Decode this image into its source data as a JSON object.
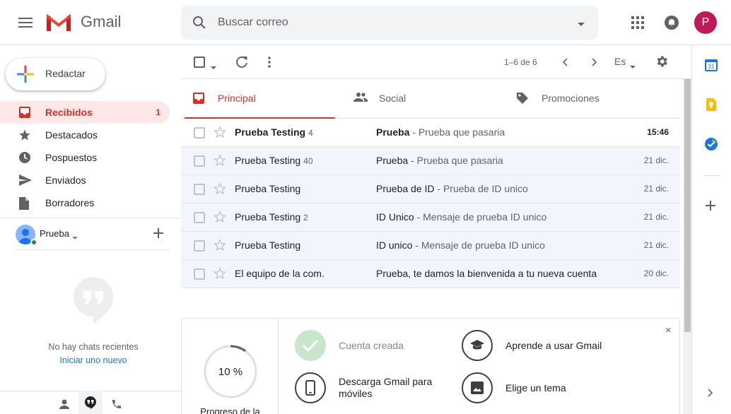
{
  "app": {
    "name": "Gmail"
  },
  "colors": {
    "accent_red": "#d93025",
    "avatar_bg": "#c2185b",
    "read_row_bg": "#f2f6fc",
    "done_green": "#c8e6c9"
  },
  "header": {
    "search_placeholder": "Buscar correo",
    "avatar_letter": "P",
    "icons": [
      "menu-icon",
      "gmail-logo",
      "search-icon",
      "search-options-icon",
      "apps-icon",
      "notifications-icon"
    ]
  },
  "sidebar": {
    "compose_label": "Redactar",
    "nav": [
      {
        "label": "Recibidos",
        "count": "1",
        "icon": "inbox-icon"
      },
      {
        "label": "Destacados",
        "count": "",
        "icon": "star-icon"
      },
      {
        "label": "Pospuestos",
        "count": "",
        "icon": "clock-icon"
      },
      {
        "label": "Enviados",
        "count": "",
        "icon": "send-icon"
      },
      {
        "label": "Borradores",
        "count": "",
        "icon": "draft-icon"
      }
    ],
    "hangouts": {
      "user": "Prueba",
      "no_chats": "No hay chats recientes",
      "start_new": "Iniciar uno nuevo"
    }
  },
  "toolbar": {
    "range": "1–6 de 6",
    "language": "Es"
  },
  "tabs": [
    {
      "label": "Principal",
      "icon": "inbox-icon",
      "active": true
    },
    {
      "label": "Social",
      "icon": "people-icon",
      "active": false
    },
    {
      "label": "Promociones",
      "icon": "tag-icon",
      "active": false
    }
  ],
  "emails": [
    {
      "sender": "Prueba Testing",
      "count": "4",
      "subject": "Prueba",
      "snippet": "Prueba que pasaria",
      "date": "15:46",
      "unread": true
    },
    {
      "sender": "Prueba Testing",
      "count": "40",
      "subject": "Prueba",
      "snippet": "Prueba que pasaria",
      "date": "21 dic.",
      "unread": false
    },
    {
      "sender": "Prueba Testing",
      "count": "",
      "subject": "Prueba de ID",
      "snippet": "Prueba de ID unico",
      "date": "21 dic.",
      "unread": false
    },
    {
      "sender": "Prueba Testing",
      "count": "2",
      "subject": "ID Unico",
      "snippet": "Mensaje de prueba ID unico",
      "date": "21 dic.",
      "unread": false
    },
    {
      "sender": "Prueba Testing",
      "count": "",
      "subject": "ID unico",
      "snippet": "Mensaje de prueba ID unico",
      "date": "21 dic.",
      "unread": false
    },
    {
      "sender": "El equipo de la com.",
      "count": "",
      "subject": "Prueba, te damos la bienvenida a tu nueva cuenta",
      "snippet": "",
      "date": "20 dic.",
      "unread": false
    }
  ],
  "onboarding": {
    "progress": 0.1,
    "progress_label": "10 %",
    "caption": "Progreso de la",
    "items": {
      "created": "Cuenta creada",
      "learn": "Aprende a usar Gmail",
      "mobile": "Descarga Gmail para móviles",
      "theme": "Elige un tema"
    },
    "close": "×"
  }
}
